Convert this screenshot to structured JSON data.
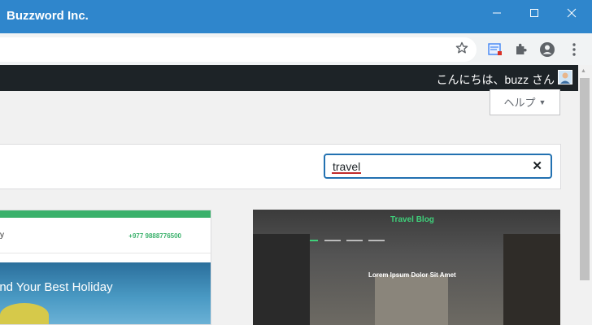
{
  "window": {
    "title": "Buzzword Inc.",
    "controls": [
      "minimize",
      "maximize",
      "close"
    ]
  },
  "admin_bar": {
    "greeting": "こんにちは、buzz さん"
  },
  "help": {
    "label": "ヘルプ",
    "arrow": "▼"
  },
  "search": {
    "value": "travel",
    "clear_symbol": "✕"
  },
  "themes": [
    {
      "phone": "+977 9888776500",
      "headline": "ind Your Best Holiday"
    },
    {
      "brand": "Travel Blog",
      "title": "Lorem Ipsum Dolor Sit Amet"
    }
  ],
  "colors": {
    "titlebar": "#2f86cc",
    "adminbar": "#1d2327",
    "search_focus": "#2271b1",
    "theme_green": "#3ab16b"
  }
}
